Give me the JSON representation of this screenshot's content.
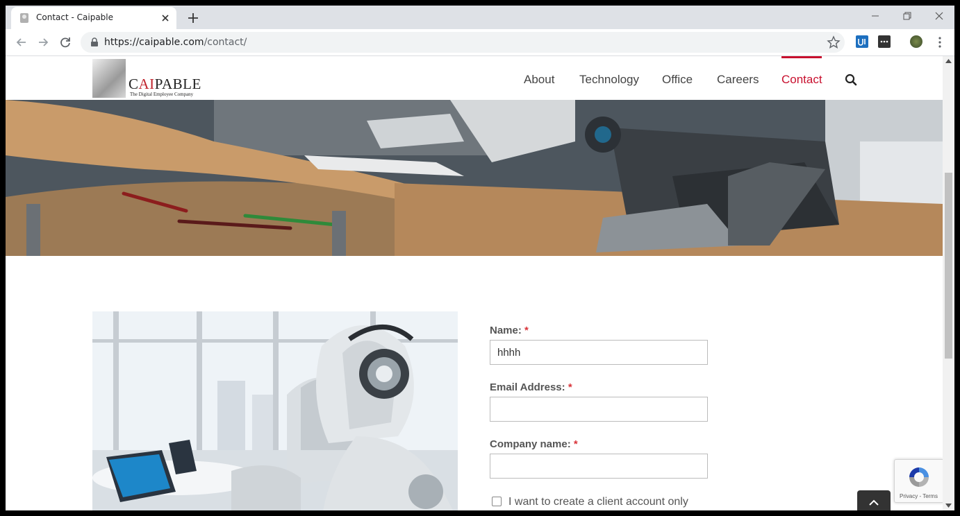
{
  "browser": {
    "tab_title": "Contact - Caipable",
    "url_host": "https://caipable.com",
    "url_path": "/contact/"
  },
  "site": {
    "logo_prefix": "C",
    "logo_ai": "AI",
    "logo_suffix": "PABLE",
    "logo_tagline": "The Digital Employee Company",
    "nav": [
      {
        "label": "About",
        "active": false
      },
      {
        "label": "Technology",
        "active": false
      },
      {
        "label": "Office",
        "active": false
      },
      {
        "label": "Careers",
        "active": false
      },
      {
        "label": "Contact",
        "active": true
      }
    ]
  },
  "form": {
    "name_label": "Name:",
    "name_value": "hhhh",
    "email_label": "Email Address:",
    "email_value": "",
    "company_label": "Company name:",
    "company_value": "",
    "required_mark": "*",
    "checkbox_label": "I want to create a client account only",
    "checkbox_checked": false
  },
  "recaptcha": {
    "text": "Privacy - Terms"
  },
  "colors": {
    "accent": "#c8102e",
    "required": "#d9343a"
  }
}
